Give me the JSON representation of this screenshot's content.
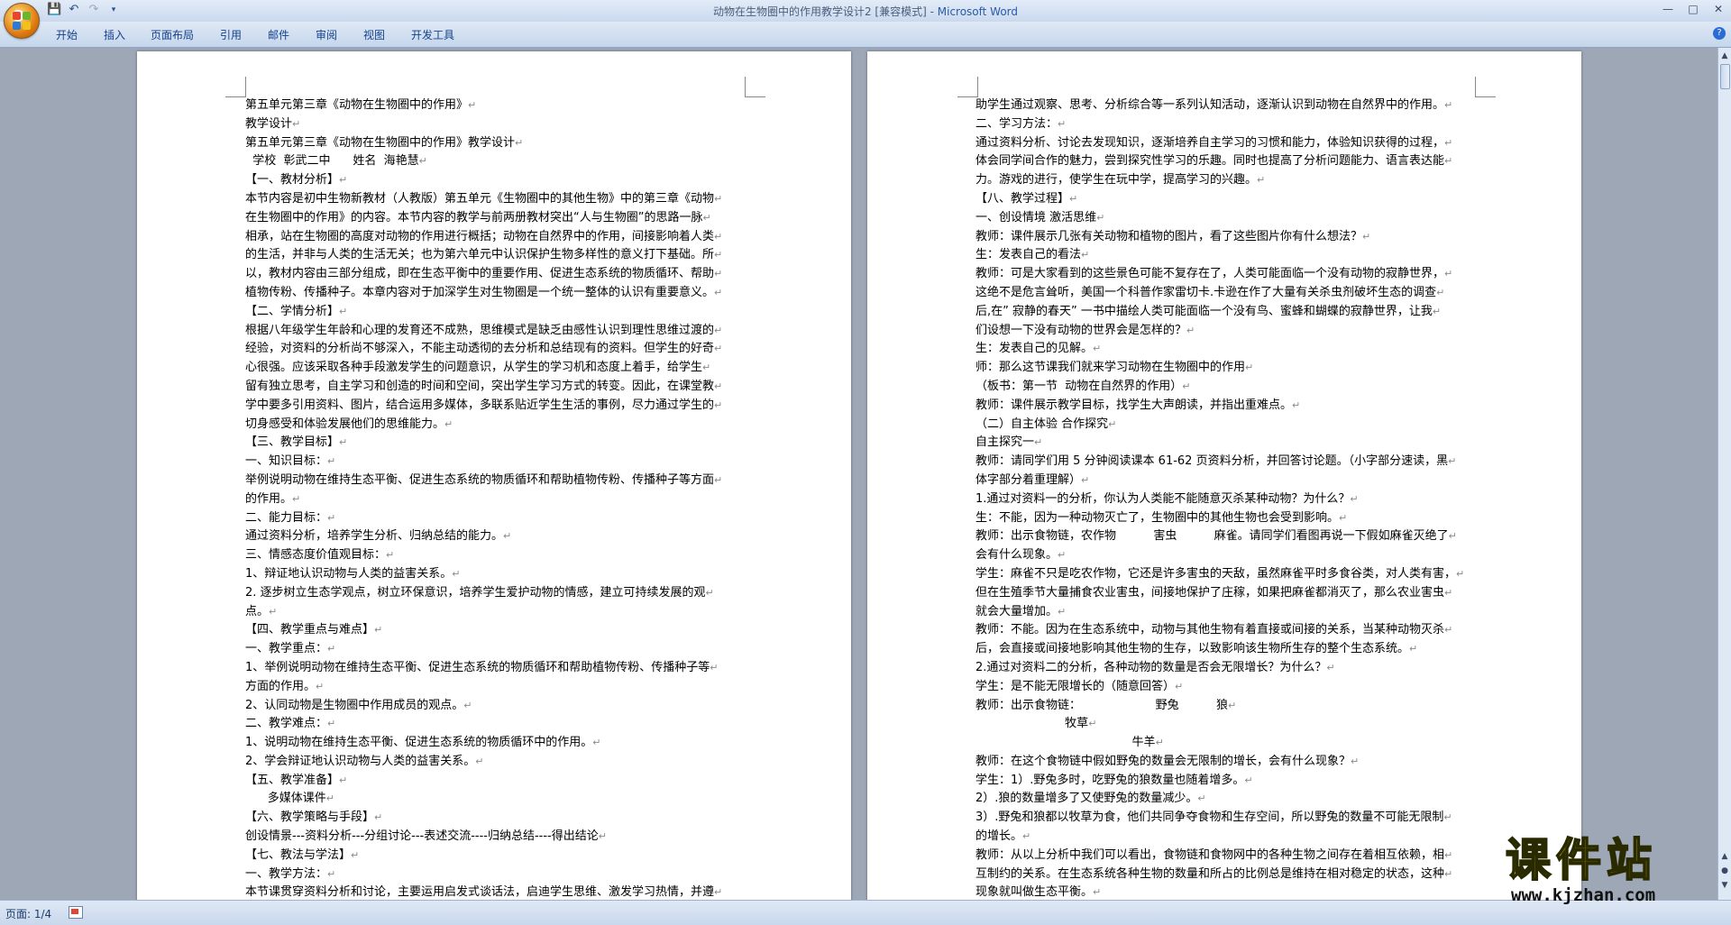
{
  "window": {
    "title": "动物在生物圈中的作用教学设计2 [兼容模式] - ",
    "app_name": "Microsoft Word"
  },
  "ribbon": {
    "tabs": [
      "开始",
      "插入",
      "页面布局",
      "引用",
      "邮件",
      "审阅",
      "视图",
      "开发工具"
    ]
  },
  "colors": {
    "accent": "#15428b",
    "page": "#ffffff",
    "workspace": "#9da7b6",
    "watermark": "#f2e10a"
  },
  "icons": [
    "office-button-icon",
    "save-icon",
    "undo-icon",
    "redo-icon",
    "customize-qat-icon",
    "minimize-icon",
    "maximize-icon",
    "close-icon",
    "help-icon",
    "status-macro-icon"
  ],
  "pages": {
    "left": [
      "第五单元第三章《动物在生物圈中的作用》",
      "教学设计",
      "第五单元第三章《动物在生物圈中的作用》教学设计",
      "  学校  彰武二中      姓名  海艳慧",
      "【一、教材分析】",
      "本节内容是初中生物新教材（人教版）第五单元《生物圈中的其他生物》中的第三章《动物",
      "在生物圈中的作用》的内容。本节内容的教学与前两册教材突出“人与生物圈”的思路一脉",
      "相承，站在生物圈的高度对动物的作用进行概括；动物在自然界中的作用，间接影响着人类",
      "的生活，并非与人类的生活无关；也为第六单元中认识保护生物多样性的意义打下基础。所",
      "以，教材内容由三部分组成，即在生态平衡中的重要作用、促进生态系统的物质循环、帮助",
      "植物传粉、传播种子。本章内容对于加深学生对生物圈是一个统一整体的认识有重要意义。",
      "【二、学情分析】",
      "根据八年级学生年龄和心理的发育还不成熟，思维模式是缺乏由感性认识到理性思维过渡的",
      "经验，对资料的分析尚不够深入，不能主动透彻的去分析和总结现有的资料。但学生的好奇",
      "心很强。应该采取各种手段激发学生的问题意识，从学生的学习机和态度上着手，给学生",
      "留有独立思考，自主学习和创造的时间和空间，突出学生学习方式的转变。因此，在课堂教",
      "学中要多引用资料、图片，结合运用多媒体，多联系贴近学生生活的事例，尽力通过学生的",
      "切身感受和体验发展他们的思维能力。",
      "【三、教学目标】",
      "一、知识目标：",
      "举例说明动物在维持生态平衡、促进生态系统的物质循环和帮助植物传粉、传播种子等方面",
      "的作用。",
      "二、能力目标：",
      "通过资料分析，培养学生分析、归纳总结的能力。",
      "三、情感态度价值观目标：",
      "1、辩证地认识动物与人类的益害关系。",
      "2. 逐步树立生态学观点，树立环保意识，培养学生爱护动物的情感，建立可持续发展的观",
      "点。",
      "【四、教学重点与难点】",
      "一、教学重点：",
      "1、举例说明动物在维持生态平衡、促进生态系统的物质循环和帮助植物传粉、传播种子等",
      "方面的作用。",
      "2、认同动物是生物圈中作用成员的观点。",
      "二、教学难点：",
      "1、说明动物在维持生态平衡、促进生态系统的物质循环中的作用。",
      "2、学会辩证地认识动物与人类的益害关系。",
      "【五、教学准备】",
      "      多媒体课件",
      "【六、教学策略与手段】",
      "创设情景---资料分析---分组讨论---表述交流----归纳总结----得出结论",
      "【七、教法与学法】",
      "一、教学方法：",
      "本节课贯穿资料分析和讨论，主要运用启发式谈话法，启迪学生思维、激发学习热情，并遵"
    ],
    "right": [
      "助学生通过观察、思考、分析综合等一系列认知活动，逐渐认识到动物在自然界中的作用。",
      "二、学习方法：",
      "通过资料分析、讨论去发现知识，逐渐培养自主学习的习惯和能力，体验知识获得的过程，",
      "体会同学间合作的魅力，尝到探究性学习的乐趣。同时也提高了分析问题能力、语言表达能",
      "力。游戏的进行，使学生在玩中学，提高学习的兴趣。",
      "【八、教学过程】",
      "一、创设情境 激活思维",
      "教师：课件展示几张有关动物和植物的图片，看了这些图片你有什么想法？",
      "生：发表自己的看法",
      "教师：可是大家看到的这些景色可能不复存在了，人类可能面临一个没有动物的寂静世界，",
      "这绝不是危言耸听，美国一个科普作家雷切卡.卡逊在作了大量有关杀虫剂破坏生态的调查",
      "后,在” 寂静的春天” 一书中描绘人类可能面临一个没有鸟、蜜蜂和蝴蝶的寂静世界，让我",
      "们设想一下没有动物的世界会是怎样的？",
      "生：发表自己的见解。",
      "师：那么这节课我们就来学习动物在生物圈中的作用",
      "（板书：第一节  动物在自然界的作用）",
      "教师：课件展示教学目标，找学生大声朗读，并指出重难点。",
      "（二）自主体验 合作探究",
      "自主探究一",
      "教师：请同学们用 5 分钟阅读课本 61-62 页资料分析，并回答讨论题。（小字部分速读，黑",
      "体字部分着重理解）",
      "1.通过对资料一的分析，你认为人类能不能随意灭杀某种动物？为什么？",
      "生：不能，因为一种动物灭亡了，生物圈中的其他生物也会受到影响。",
      "教师：出示食物链，农作物          害虫          麻雀。请同学们看图再说一下假如麻雀灭绝了",
      "会有什么现象。",
      "学生：麻雀不只是吃农作物，它还是许多害虫的天敌，虽然麻雀平时多食谷类，对人类有害，",
      "但在生殖季节大量捕食农业害虫，间接地保护了庄稼，如果把麻雀都消灭了，那么农业害虫",
      "就会大量增加。",
      "教师：不能。因为在生态系统中，动物与其他生物有着直接或间接的关系，当某种动物灭杀",
      "后，会直接或间接地影响其他生物的生存，以致影响该生物所生存的整个生态系统。",
      "2.通过对资料二的分析，各种动物的数量是否会无限增长？为什么？",
      "学生：是不能无限增长的（随意回答）",
      "教师：出示食物链：                    野兔          狼",
      "                        牧草",
      "                                          牛羊",
      "教师：在这个食物链中假如野兔的数量会无限制的增长，会有什么现象？",
      "学生：1）.野兔多时，吃野兔的狼数量也随着增多。",
      "2）.狼的数量增多了又使野兔的数量减少。",
      "3）.野兔和狼都以牧草为食，他们共同争夺食物和生存空间，所以野兔的数量不可能无限制",
      "的增长。",
      "教师：从以上分析中我们可以看出，食物链和食物网中的各种生物之间存在着相互依赖，相",
      "互制约的关系。在生态系统各种生物的数量和所占的比例总是维持在相对稳定的状态，这种",
      "现象就叫做生态平衡。"
    ]
  },
  "status": {
    "page": "页面: 1/4"
  },
  "watermark": {
    "title": "课件站",
    "url": "www.kjzhan.com"
  }
}
